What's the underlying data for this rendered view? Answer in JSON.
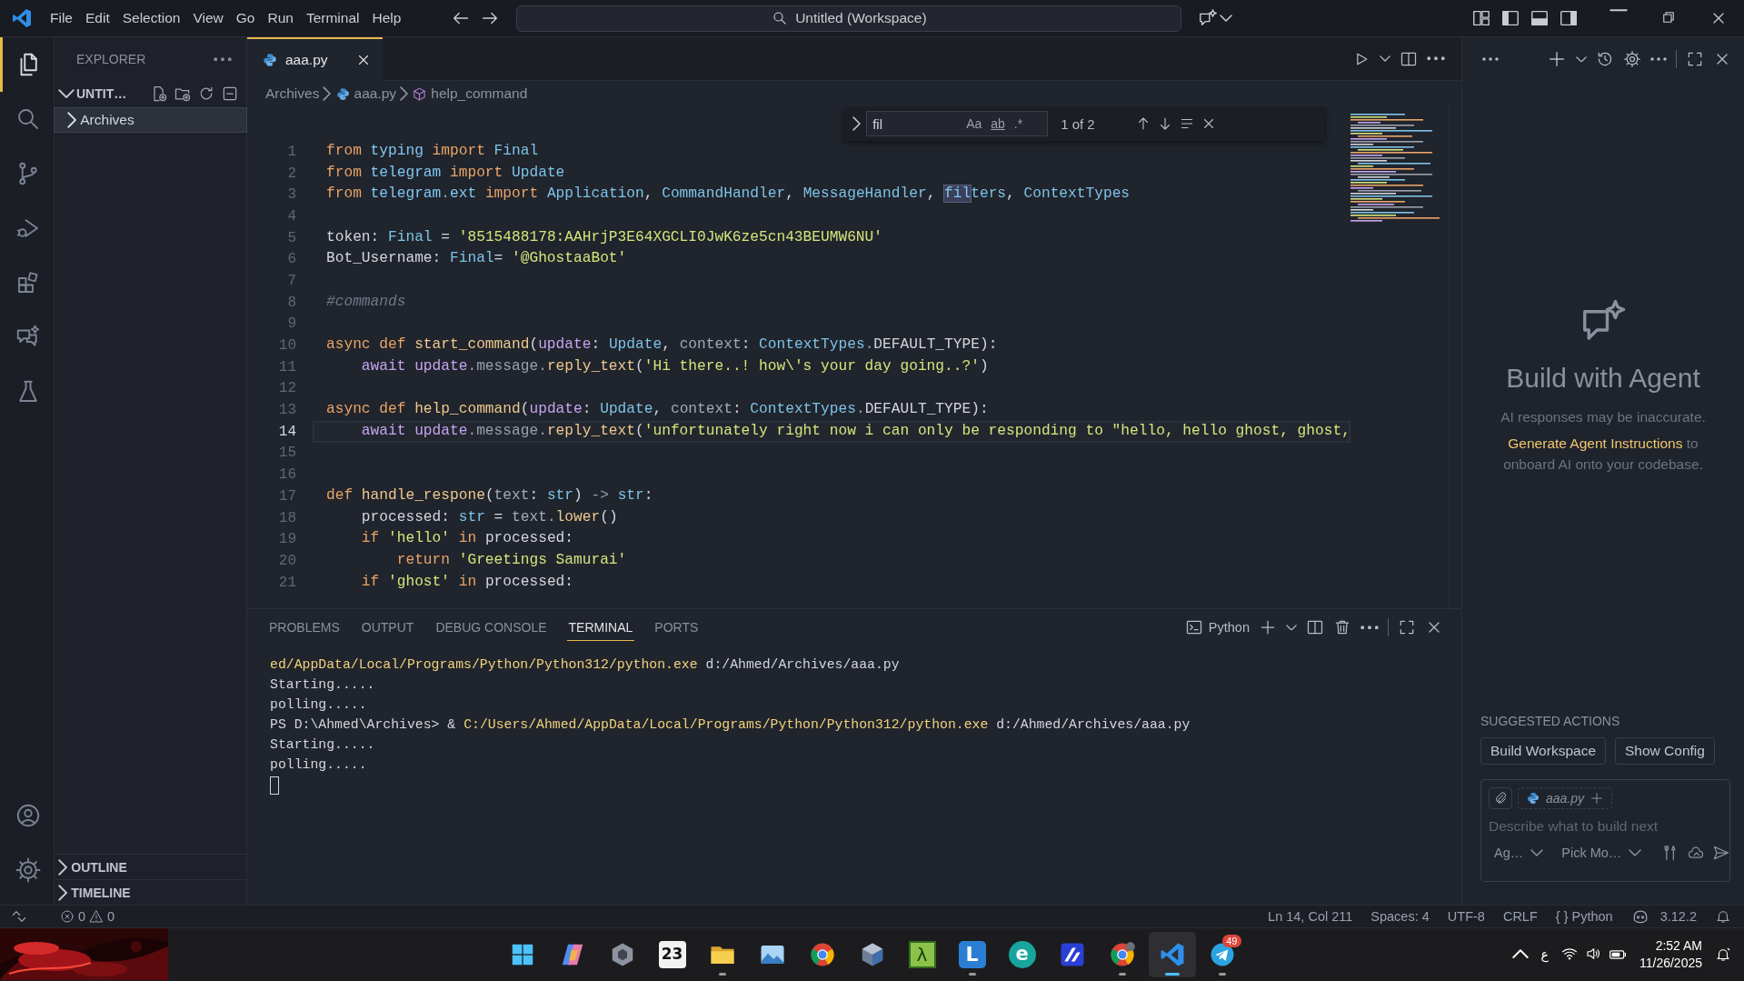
{
  "title_bar": {
    "menu": [
      "File",
      "Edit",
      "Selection",
      "View",
      "Go",
      "Run",
      "Terminal",
      "Help"
    ],
    "search": "Untitled (Workspace)"
  },
  "activity_bar": {
    "items": [
      {
        "kind": "explorer",
        "selected": true
      },
      {
        "kind": "search",
        "selected": false
      },
      {
        "kind": "source-control",
        "selected": false
      },
      {
        "kind": "run",
        "selected": false
      },
      {
        "kind": "extensions",
        "selected": false
      },
      {
        "kind": "chat",
        "selected": false
      },
      {
        "kind": "testing",
        "selected": false
      }
    ]
  },
  "sidebar": {
    "title": "EXPLORER",
    "section": "UNTIT…",
    "section_expanded": true,
    "tree": [
      {
        "label": "Archives",
        "expanded": false,
        "selected": true
      }
    ],
    "bottom_sections": [
      {
        "label": "OUTLINE",
        "expanded": false
      },
      {
        "label": "TIMELINE",
        "expanded": false
      }
    ]
  },
  "editor": {
    "tabs": [
      {
        "label": "aaa.py",
        "selected": true
      }
    ],
    "breadcrumbs": [
      {
        "kind": "folder",
        "label": "Archives"
      },
      {
        "kind": "python",
        "label": "aaa.py"
      },
      {
        "kind": "method",
        "label": "help_command"
      }
    ],
    "find": {
      "value": "fil",
      "options": [
        {
          "label": "Aa",
          "on": false
        },
        {
          "label": "ab",
          "on": false
        },
        {
          "label": ".*",
          "on": false
        }
      ],
      "result": "1 of 2"
    },
    "lines": [
      {
        "number": "1",
        "current": false,
        "tokens": [
          {
            "kind": "keyword",
            "text": "from"
          },
          {
            "kind": "module",
            "text": " typing "
          },
          {
            "kind": "keyword",
            "text": "import"
          },
          {
            "kind": "type",
            "text": " Final"
          }
        ]
      },
      {
        "number": "2",
        "current": false,
        "tokens": [
          {
            "kind": "keyword",
            "text": "from"
          },
          {
            "kind": "module",
            "text": " telegram "
          },
          {
            "kind": "keyword",
            "text": "import"
          },
          {
            "kind": "type",
            "text": " Update"
          }
        ]
      },
      {
        "number": "3",
        "current": false,
        "tokens": [
          {
            "kind": "keyword",
            "text": "from"
          },
          {
            "kind": "module",
            "text": " telegram"
          },
          {
            "kind": "punct",
            "text": "."
          },
          {
            "kind": "module",
            "text": "ext "
          },
          {
            "kind": "keyword",
            "text": "import"
          },
          {
            "kind": "type",
            "text": " Application"
          },
          {
            "kind": "plain",
            "text": ", "
          },
          {
            "kind": "type",
            "text": "CommandHandler"
          },
          {
            "kind": "plain",
            "text": ", "
          },
          {
            "kind": "type",
            "text": "MessageHandler"
          },
          {
            "kind": "plain",
            "text": ", "
          },
          {
            "kind": "match",
            "text": "fil"
          },
          {
            "kind": "type",
            "text": "ters"
          },
          {
            "kind": "plain",
            "text": ", "
          },
          {
            "kind": "type",
            "text": "ContextTypes"
          }
        ]
      },
      {
        "number": "4",
        "current": false
      },
      {
        "number": "5",
        "current": false,
        "tokens": [
          {
            "kind": "plain",
            "text": "token: "
          },
          {
            "kind": "type",
            "text": "Final"
          },
          {
            "kind": "plain",
            "text": " = "
          },
          {
            "kind": "string",
            "text": "'8515488178:AAHrjP3E64XGCLI0JwK6ze5cn43BEUMW6NU'"
          }
        ]
      },
      {
        "number": "6",
        "current": false,
        "tokens": [
          {
            "kind": "plain",
            "text": "Bot_Username: "
          },
          {
            "kind": "type",
            "text": "Final"
          },
          {
            "kind": "plain",
            "text": "= "
          },
          {
            "kind": "string",
            "text": "'@GhostaaBot'"
          }
        ]
      },
      {
        "number": "7",
        "current": false
      },
      {
        "number": "8",
        "current": false,
        "tokens": [
          {
            "kind": "comment",
            "text": "#commands"
          }
        ]
      },
      {
        "number": "9",
        "current": false
      },
      {
        "number": "10",
        "current": false,
        "tokens": [
          {
            "kind": "keyword",
            "text": "async def"
          },
          {
            "kind": "function",
            "text": " start_command"
          },
          {
            "kind": "plain",
            "text": "("
          },
          {
            "kind": "variable",
            "text": "update"
          },
          {
            "kind": "plain",
            "text": ": "
          },
          {
            "kind": "type",
            "text": "Update"
          },
          {
            "kind": "plain",
            "text": ", "
          },
          {
            "kind": "parameter",
            "text": "context"
          },
          {
            "kind": "plain",
            "text": ": "
          },
          {
            "kind": "type",
            "text": "ContextTypes"
          },
          {
            "kind": "punct",
            "text": "."
          },
          {
            "kind": "plain",
            "text": "DEFAULT_TYPE):"
          }
        ]
      },
      {
        "number": "11",
        "current": false,
        "tokens": [
          {
            "kind": "control",
            "text": "    await"
          },
          {
            "kind": "variable",
            "text": " update"
          },
          {
            "kind": "punct",
            "text": ".message."
          },
          {
            "kind": "function",
            "text": "reply_text"
          },
          {
            "kind": "plain",
            "text": "("
          },
          {
            "kind": "string",
            "text": "'Hi there..! how\\'s your day going..?'"
          },
          {
            "kind": "plain",
            "text": ")"
          }
        ]
      },
      {
        "number": "12",
        "current": false
      },
      {
        "number": "13",
        "current": false,
        "tokens": [
          {
            "kind": "keyword",
            "text": "async def"
          },
          {
            "kind": "function",
            "text": " help_command"
          },
          {
            "kind": "plain",
            "text": "("
          },
          {
            "kind": "variable",
            "text": "update"
          },
          {
            "kind": "plain",
            "text": ": "
          },
          {
            "kind": "type",
            "text": "Update"
          },
          {
            "kind": "plain",
            "text": ", "
          },
          {
            "kind": "parameter",
            "text": "context"
          },
          {
            "kind": "plain",
            "text": ": "
          },
          {
            "kind": "type",
            "text": "ContextTypes"
          },
          {
            "kind": "punct",
            "text": "."
          },
          {
            "kind": "plain",
            "text": "DEFAULT_TYPE):"
          }
        ]
      },
      {
        "number": "14",
        "current": true,
        "tokens": [
          {
            "kind": "control",
            "text": "    await"
          },
          {
            "kind": "variable",
            "text": " update"
          },
          {
            "kind": "punct",
            "text": ".message."
          },
          {
            "kind": "function",
            "text": "reply_text"
          },
          {
            "kind": "plain",
            "text": "("
          },
          {
            "kind": "string",
            "text": "'unfortunately right now i can only be responding to \"hello, hello ghost, ghost,"
          }
        ]
      },
      {
        "number": "15",
        "current": false
      },
      {
        "number": "16",
        "current": false
      },
      {
        "number": "17",
        "current": false,
        "tokens": [
          {
            "kind": "keyword",
            "text": "def"
          },
          {
            "kind": "function",
            "text": " handle_respone"
          },
          {
            "kind": "plain",
            "text": "("
          },
          {
            "kind": "parameter",
            "text": "text"
          },
          {
            "kind": "plain",
            "text": ": "
          },
          {
            "kind": "type",
            "text": "str"
          },
          {
            "kind": "plain",
            "text": ") "
          },
          {
            "kind": "punct",
            "text": "->"
          },
          {
            "kind": "type",
            "text": " str"
          },
          {
            "kind": "plain",
            "text": ":"
          }
        ]
      },
      {
        "number": "18",
        "current": false,
        "tokens": [
          {
            "kind": "plain",
            "text": "    processed: "
          },
          {
            "kind": "type",
            "text": "str"
          },
          {
            "kind": "plain",
            "text": " = "
          },
          {
            "kind": "parameter",
            "text": "text"
          },
          {
            "kind": "punct",
            "text": "."
          },
          {
            "kind": "function",
            "text": "lower"
          },
          {
            "kind": "plain",
            "text": "()"
          }
        ]
      },
      {
        "number": "19",
        "current": false,
        "tokens": [
          {
            "kind": "keyword",
            "text": "    if"
          },
          {
            "kind": "string",
            "text": " 'hello'"
          },
          {
            "kind": "keyword",
            "text": " in"
          },
          {
            "kind": "plain",
            "text": " processed:"
          }
        ]
      },
      {
        "number": "20",
        "current": false,
        "tokens": [
          {
            "kind": "keyword",
            "text": "        return"
          },
          {
            "kind": "string",
            "text": " 'Greetings Samurai'"
          }
        ]
      },
      {
        "number": "21",
        "current": false,
        "tokens": [
          {
            "kind": "keyword",
            "text": "    if"
          },
          {
            "kind": "string",
            "text": " 'ghost'"
          },
          {
            "kind": "keyword",
            "text": " in"
          },
          {
            "kind": "plain",
            "text": " processed:"
          }
        ]
      }
    ]
  },
  "panel": {
    "tabs": [
      {
        "label": "PROBLEMS",
        "selected": false
      },
      {
        "label": "OUTPUT",
        "selected": false
      },
      {
        "label": "DEBUG CONSOLE",
        "selected": false
      },
      {
        "label": "TERMINAL",
        "selected": true
      },
      {
        "label": "PORTS",
        "selected": false
      }
    ],
    "terminal_name": "Python",
    "lines": [
      {
        "tokens": [
          {
            "kind": "path",
            "text": "ed/AppData/Local/Programs/Python/Python312/python.exe"
          },
          {
            "kind": "plain",
            "text": " d:/Ahmed/Archives/aaa.py"
          }
        ]
      },
      {
        "tokens": [
          {
            "kind": "plain",
            "text": "Starting....."
          }
        ]
      },
      {
        "tokens": [
          {
            "kind": "plain",
            "text": "polling....."
          }
        ]
      },
      {
        "tokens": [
          {
            "kind": "plain",
            "text": "PS D:\\Ahmed\\Archives> & "
          },
          {
            "kind": "path",
            "text": "C:/Users/Ahmed/AppData/Local/Programs/Python/Python312/python.exe"
          },
          {
            "kind": "plain",
            "text": " d:/Ahmed/Archives/aaa.py"
          }
        ]
      },
      {
        "tokens": [
          {
            "kind": "plain",
            "text": "Starting....."
          }
        ]
      },
      {
        "tokens": [
          {
            "kind": "plain",
            "text": "polling....."
          }
        ]
      }
    ]
  },
  "chat": {
    "title": "Build with Agent",
    "disclaimer": "AI responses may be inaccurate.",
    "link": "Generate Agent Instructions",
    "link_rest": " to onboard AI onto your codebase.",
    "suggested_title": "SUGGESTED ACTIONS",
    "suggested": [
      "Build Workspace",
      "Show Config"
    ],
    "attachment": "aaa.py",
    "placeholder": "Describe what to build next",
    "mode": "Ag…",
    "model": "Pick Mo…"
  },
  "status_bar": {
    "errors": "0",
    "warnings": "0",
    "items": [
      "Ln 14, Col 211",
      "Spaces: 4",
      "UTF-8",
      "CRLF",
      "{ } Python"
    ],
    "python_version": "3.12.2"
  },
  "taskbar": {
    "apps": [
      {
        "kind": "start",
        "open": false,
        "active": false
      },
      {
        "kind": "copilot",
        "open": false,
        "active": false
      },
      {
        "kind": "hexagon",
        "open": false,
        "active": false
      },
      {
        "kind": "calendar",
        "text": "23",
        "open": false,
        "active": false
      },
      {
        "kind": "folder",
        "open": true,
        "active": false
      },
      {
        "kind": "photos",
        "open": false,
        "active": false
      },
      {
        "kind": "browser",
        "open": false,
        "active": false
      },
      {
        "kind": "cube",
        "open": false,
        "active": false
      },
      {
        "kind": "lambda",
        "text": "λ",
        "open": false,
        "active": false
      },
      {
        "kind": "l-app",
        "text": "L",
        "open": true,
        "active": false
      },
      {
        "kind": "e-app",
        "text": "e",
        "open": false,
        "active": false
      },
      {
        "kind": "slash-app",
        "open": false,
        "active": false
      },
      {
        "kind": "browser-profile",
        "open": true,
        "active": false
      },
      {
        "kind": "vscode",
        "open": true,
        "active": true
      },
      {
        "kind": "telegram",
        "badge": "49",
        "open": true,
        "active": false
      }
    ],
    "language": "ع",
    "time": "2:52 AM",
    "date": "11/26/2025"
  }
}
